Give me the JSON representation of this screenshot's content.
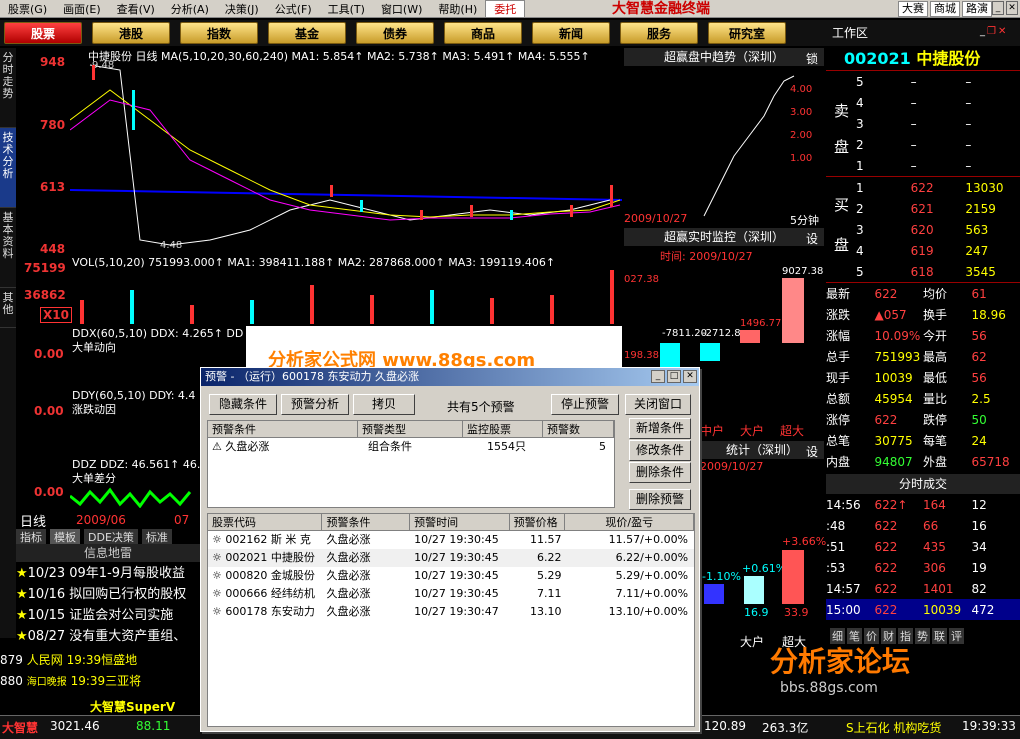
{
  "menubar": {
    "items": [
      "股票(G)",
      "画面(E)",
      "查看(V)",
      "分析(A)",
      "决策(J)",
      "公式(F)",
      "工具(T)",
      "窗口(W)",
      "帮助(H)",
      "委托"
    ],
    "brand": "大智慧金融终端",
    "right_items": [
      "大赛",
      "商城",
      "路演"
    ]
  },
  "navbar": {
    "tabs": [
      "股票",
      "港股",
      "指数",
      "基金",
      "债券",
      "商品",
      "新闻",
      "服务",
      "研究室"
    ],
    "workarea": "工作区"
  },
  "sidetabs": [
    "分时走势",
    "技术分析",
    "基本资料",
    "其他"
  ],
  "main": {
    "header": "中捷股份 日线  MA(5,10,20,30,60,240)  MA1: 5.854↑  MA2: 5.738↑  MA3: 5.491↑  MA4: 5.555↑",
    "axis": [
      "948",
      "780",
      "613",
      "448"
    ],
    "peak_label": "9.48",
    "low_label": "4.48",
    "vol_header": "VOL(5,10,20)  751993.000↑  MA1: 398411.188↑  MA2: 287868.000↑  MA3: 199119.406↑",
    "vol_axis": [
      "75199",
      "36862",
      "X10"
    ],
    "ddx_header": "DDX(60,5,10)  DDX: 4.265↑  DD",
    "ddx_label": "大单动向",
    "ddy_header": "DDY(60,5,10)  DDY: 4.4",
    "ddy_label": "涨跌动因",
    "ddz_header": "DDZ  DDZ: 46.561↑  46.5",
    "ddz_label": "大单差分",
    "ind_axis": [
      "0.00",
      "0.00",
      "0.00"
    ],
    "period": "日线",
    "date": "2009/06",
    "date2": "07",
    "tabs": [
      "指标",
      "模板",
      "DDE决策",
      "标准"
    ]
  },
  "ad": {
    "text": "分析家公式网 www.88gs.com"
  },
  "trend": {
    "title": "超赢盘中趋势（深圳）",
    "lock": "锁",
    "axis": [
      "4.00",
      "3.00",
      "2.00",
      "1.00"
    ],
    "date": "2009/10/27",
    "period": "5分钟"
  },
  "monitor": {
    "title": "超赢实时监控（深圳）",
    "btn": "设",
    "time": "时间: 2009/10/27",
    "val_top": "9027.38",
    "labels": [
      "-7811.20",
      "-2712.8",
      "1496.77"
    ],
    "axis": [
      "027.38",
      "198.38"
    ],
    "cols": [
      "中户",
      "大户",
      "超大"
    ]
  },
  "stats": {
    "title": "统计（深圳）",
    "btn": "设",
    "date": "2009/10/27",
    "pcts": [
      "-1.10%",
      "+0.61%",
      "+3.66%"
    ],
    "vals": [
      "16.9",
      "33.9"
    ],
    "cols": [
      "大户",
      "超大"
    ]
  },
  "quote": {
    "code": "002021",
    "name": "中捷股份",
    "sell": [
      [
        "5",
        "–",
        "–"
      ],
      [
        "4",
        "–",
        "–"
      ],
      [
        "3",
        "–",
        "–"
      ],
      [
        "2",
        "–",
        "–"
      ],
      [
        "1",
        "–",
        "–"
      ]
    ],
    "sell_label": [
      "卖",
      "盘"
    ],
    "buy": [
      [
        "1",
        "622",
        "13030"
      ],
      [
        "2",
        "621",
        "2159"
      ],
      [
        "3",
        "620",
        "563"
      ],
      [
        "4",
        "619",
        "247"
      ],
      [
        "5",
        "618",
        "3545"
      ]
    ],
    "buy_label": [
      "买",
      "盘"
    ],
    "info": [
      [
        "最新",
        "622",
        "均价",
        "61"
      ],
      [
        "涨跌",
        "▲057",
        "换手",
        "18.96"
      ],
      [
        "涨幅",
        "10.09%",
        "今开",
        "56"
      ],
      [
        "总手",
        "751993",
        "最高",
        "62"
      ],
      [
        "现手",
        "10039",
        "最低",
        "56"
      ],
      [
        "总额",
        "45954",
        "量比",
        "2.5"
      ],
      [
        "涨停",
        "622",
        "跌停",
        "50"
      ],
      [
        "总笔",
        "30775",
        "每笔",
        "24"
      ],
      [
        "内盘",
        "94807",
        "外盘",
        "65718"
      ]
    ],
    "ticks_title": "分时成交",
    "ticks": [
      [
        "14:56",
        "622↑",
        "164",
        "12"
      ],
      [
        ":48",
        "622",
        "66",
        "16"
      ],
      [
        ":51",
        "622",
        "435",
        "34"
      ],
      [
        ":53",
        "622",
        "306",
        "19"
      ],
      [
        "14:57",
        "622",
        "1401",
        "82"
      ],
      [
        "15:00",
        "622",
        "10039",
        "472"
      ]
    ],
    "tabs": [
      "细",
      "笔",
      "价",
      "财",
      "指",
      "势",
      "联",
      "评"
    ]
  },
  "news": [
    {
      "date": "10/23",
      "text": "09年1-9月每股收益"
    },
    {
      "date": "10/16",
      "text": "拟回购已行权的股权"
    },
    {
      "date": "10/15",
      "text": "证监会对公司实施"
    },
    {
      "date": "08/27",
      "text": "没有重大资产重组、"
    }
  ],
  "news_title": "信息地雷",
  "ticker": [
    {
      "num": "879",
      "src": "人民网",
      "time": "19:39",
      "text": "恒盛地"
    },
    {
      "num": "880",
      "src": "海口晚报",
      "time": "19:39",
      "text": "三亚将"
    }
  ],
  "bottom": {
    "logo": "大智慧",
    "index1": "3021.46",
    "index2": "88.11",
    "index3": "120.89",
    "index4": "263.3亿",
    "marquee": "S上石化 机构吃货",
    "brand2": "大智慧SuperV",
    "clock": "19:39:33"
  },
  "dialog": {
    "title": "预警 - （运行）600178 东安动力 久盘必涨",
    "btns": [
      "隐藏条件",
      "预警分析",
      "拷贝"
    ],
    "count": "共有5个预警",
    "stop": "停止预警",
    "close": "关闭窗口",
    "side": [
      "新增条件",
      "修改条件",
      "删除条件",
      "删除预警"
    ],
    "cond_headers": [
      "预警条件",
      "预警类型",
      "监控股票",
      "预警数"
    ],
    "cond_rows": [
      [
        "久盘必涨",
        "组合条件",
        "1554只",
        "5"
      ]
    ],
    "alert_headers": [
      "股票代码",
      "预警条件",
      "预警时间",
      "预警价格",
      "现价/盈亏"
    ],
    "alert_rows": [
      [
        "002162",
        "斯 米 克",
        "久盘必涨",
        "10/27  19:30:45",
        "11.57",
        "11.57/+0.00%"
      ],
      [
        "002021",
        "中捷股份",
        "久盘必涨",
        "10/27  19:30:45",
        "6.22",
        "6.22/+0.00%"
      ],
      [
        "000820",
        "金城股份",
        "久盘必涨",
        "10/27  19:30:45",
        "5.29",
        "5.29/+0.00%"
      ],
      [
        "000666",
        "经纬纺机",
        "久盘必涨",
        "10/27  19:30:45",
        "7.11",
        "7.11/+0.00%"
      ],
      [
        "600178",
        "东安动力",
        "久盘必涨",
        "10/27  19:30:47",
        "13.10",
        "13.10/+0.00%"
      ]
    ]
  },
  "watermark": {
    "text": "分析家论坛",
    "url": "bbs.88gs.com"
  }
}
